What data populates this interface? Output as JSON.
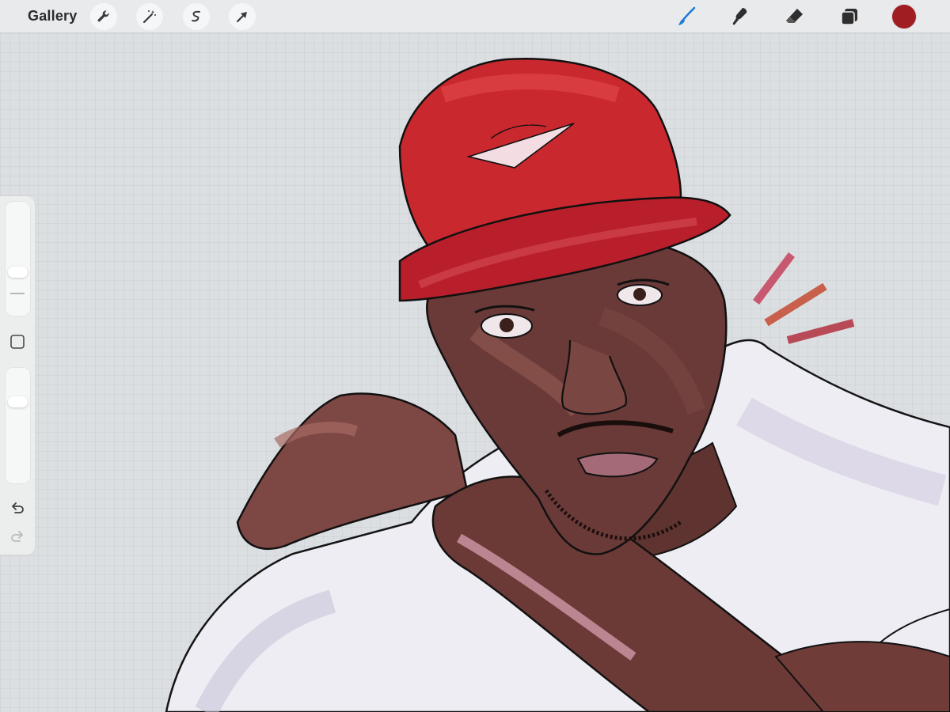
{
  "toolbar": {
    "gallery_label": "Gallery",
    "left_tools": [
      "wrench-icon",
      "magic-wand-icon",
      "selection-icon",
      "transform-arrow-icon"
    ],
    "right_tools": [
      "brush-icon",
      "smudge-icon",
      "eraser-icon",
      "layers-icon"
    ],
    "active_tool": "brush-icon",
    "active_color": "#a01e22",
    "accent_color": "#1e7bd8"
  },
  "sidebar": {
    "controls": [
      "brush-size-slider",
      "modify-button",
      "opacity-slider",
      "undo-icon",
      "redo-icon"
    ]
  },
  "canvas": {
    "content": "digital-portrait-illustration"
  }
}
